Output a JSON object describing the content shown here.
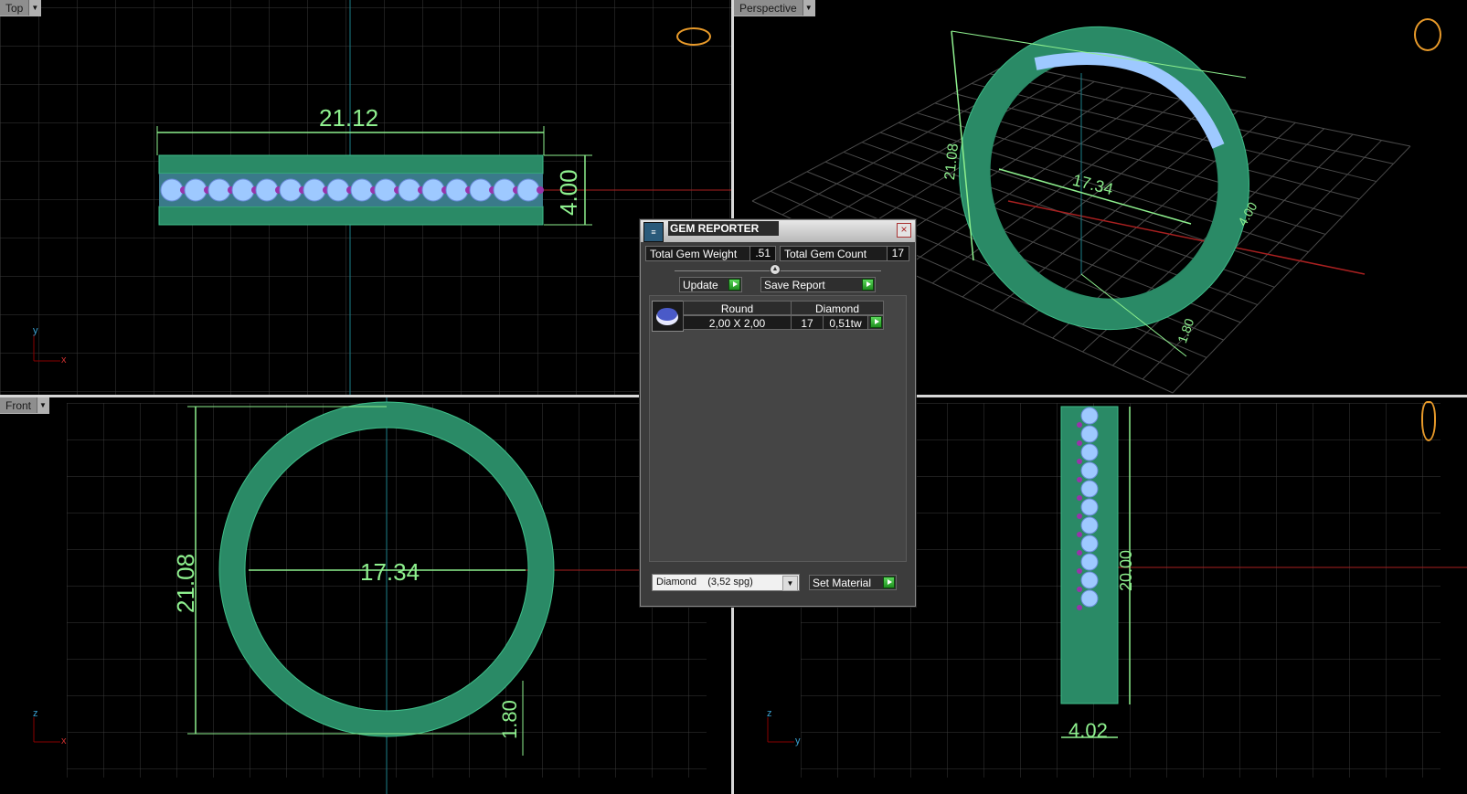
{
  "viewports": {
    "top": {
      "label": "Top",
      "dim_width": "21.12",
      "dim_height": "4.00",
      "axis_v": "y",
      "axis_h": "x"
    },
    "perspective": {
      "label": "Perspective",
      "dim_height": "21.08",
      "dim_inner": "17.34",
      "dim_side": "4.00",
      "dim_thick": "1.80"
    },
    "front": {
      "label": "Front",
      "dim_height": "21.08",
      "dim_inner": "17.34",
      "dim_thick": "1.80",
      "axis_v": "z",
      "axis_h": "x"
    },
    "right": {
      "dim_width": "4.02",
      "dim_side": "20.00",
      "axis_v": "z",
      "axis_h": "y"
    }
  },
  "gem_reporter": {
    "title": "GEM REPORTER",
    "total_weight_label": "Total Gem Weight",
    "total_weight_value": ".51",
    "total_count_label": "Total Gem Count",
    "total_count_value": "17",
    "update_label": "Update",
    "save_label": "Save Report",
    "table": {
      "headers": [
        "Round",
        "Diamond"
      ],
      "rows": [
        {
          "size": "2,00 X 2,00",
          "count": "17",
          "weight": "0,51tw"
        }
      ]
    },
    "material_value": "Diamond    (3,52 spg)",
    "set_material_label": "Set Material"
  },
  "colors": {
    "background": "#000000",
    "grid": "#3a3a3a",
    "dimension": "#8ef08e",
    "ring": "#2a8a66",
    "gem": "#9ec9ff",
    "accent_gem": "#9933aa"
  }
}
